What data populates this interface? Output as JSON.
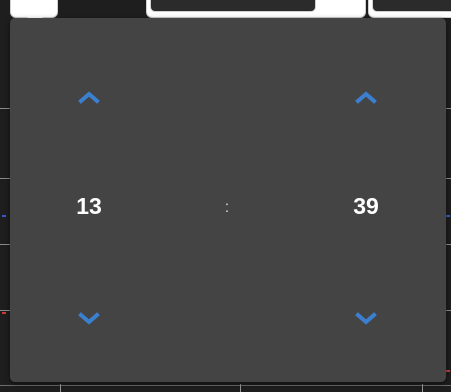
{
  "time_picker": {
    "hour": {
      "value": "13",
      "increment_icon": "chevron-up-icon",
      "decrement_icon": "chevron-down-icon"
    },
    "separator": ":",
    "minute": {
      "value": "39",
      "increment_icon": "chevron-up-icon",
      "decrement_icon": "chevron-down-icon"
    }
  },
  "colors": {
    "popover_background": "#444444",
    "chevron": "#3a7fd0",
    "value_text": "#ffffff",
    "separator_text": "#cfcfcf"
  }
}
